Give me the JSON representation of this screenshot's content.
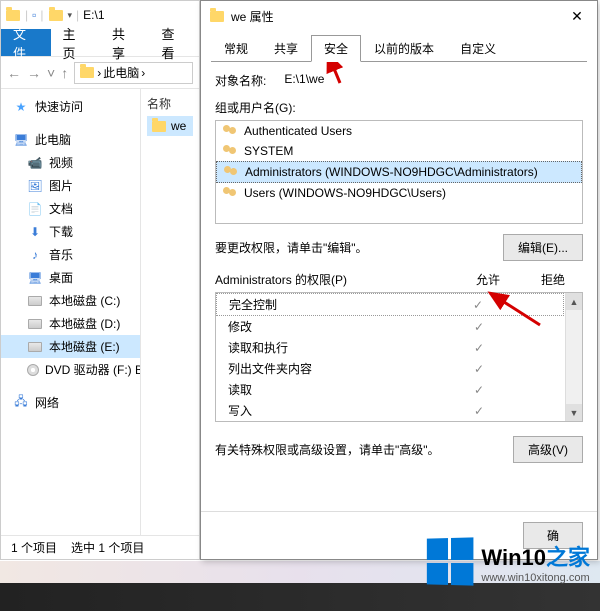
{
  "explorer": {
    "titlebar_path": "E:\\1",
    "tabs": {
      "file": "文件",
      "home": "主页",
      "share": "共享",
      "view": "查看"
    },
    "nav": {
      "back": "←",
      "fwd": "→",
      "up": "↑",
      "caret": "˅"
    },
    "addr": {
      "icon": "folder",
      "seg1": "此电脑",
      "sep": "›"
    },
    "col_name": "名称",
    "file1": "we",
    "status": {
      "items": "1 个项目",
      "selected": "选中 1 个项目"
    },
    "tree": {
      "quick": "快速访问",
      "pc": "此电脑",
      "videos": "视频",
      "pictures": "图片",
      "docs": "文档",
      "downloads": "下载",
      "music": "音乐",
      "desktop": "桌面",
      "driveC": "本地磁盘 (C:)",
      "driveD": "本地磁盘 (D:)",
      "driveE": "本地磁盘 (E:)",
      "dvd": "DVD 驱动器 (F:) Bo",
      "network": "网络"
    }
  },
  "dialog": {
    "title": "we 属性",
    "close": "✕",
    "tabs": {
      "general": "常规",
      "share": "共享",
      "security": "安全",
      "prev": "以前的版本",
      "custom": "自定义"
    },
    "obj_label": "对象名称:",
    "obj_value": "E:\\1\\we",
    "groups_label": "组或用户名(G):",
    "groups": [
      "Authenticated Users",
      "SYSTEM",
      "Administrators (WINDOWS-NO9HDGC\\Administrators)",
      "Users (WINDOWS-NO9HDGC\\Users)"
    ],
    "edit_hint": "要更改权限，请单击\"编辑\"。",
    "edit_btn": "编辑(E)...",
    "perm_label": "Administrators 的权限(P)",
    "perm_allow": "允许",
    "perm_deny": "拒绝",
    "perms": [
      {
        "name": "完全控制",
        "allow": true
      },
      {
        "name": "修改",
        "allow": true
      },
      {
        "name": "读取和执行",
        "allow": true
      },
      {
        "name": "列出文件夹内容",
        "allow": true
      },
      {
        "name": "读取",
        "allow": true
      },
      {
        "name": "写入",
        "allow": true
      }
    ],
    "adv_hint": "有关特殊权限或高级设置，请单击\"高级\"。",
    "adv_btn": "高级(V)",
    "ok_btn": "确"
  },
  "watermark": {
    "brand1": "Win10",
    "brand2": "之家",
    "url": "www.win10xitong.com"
  }
}
